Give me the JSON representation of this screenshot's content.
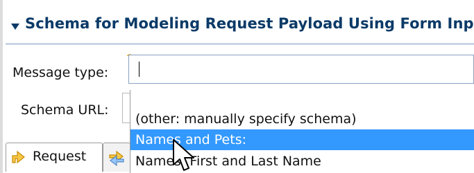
{
  "section": {
    "title": "Schema for Modeling Request Payload Using Form Input",
    "twisty_icon": "chevron-down-icon"
  },
  "form": {
    "message_type_label": "Message type:",
    "message_type_value": "",
    "schema_url_label": "Schema URL:",
    "schema_url_value": ""
  },
  "dropdown": {
    "items": [
      {
        "label": "(other: manually specify schema)",
        "selected": false
      },
      {
        "label": "Names and Pets:",
        "selected": true
      },
      {
        "label": "Names: First and Last Name",
        "selected": false
      }
    ]
  },
  "tabs": {
    "request_label": "Request",
    "request_icon": "request-arrow-icon",
    "response_icon": "response-arrow-icon"
  },
  "colors": {
    "section_title": "#0b3a67",
    "selection_bg": "#3399ff",
    "input_border": "#8aa0bf",
    "icon_orange": "#e8a317"
  },
  "icons": {
    "info_icon": "question-mark-icon",
    "cursor": "mouse-pointer-icon"
  }
}
